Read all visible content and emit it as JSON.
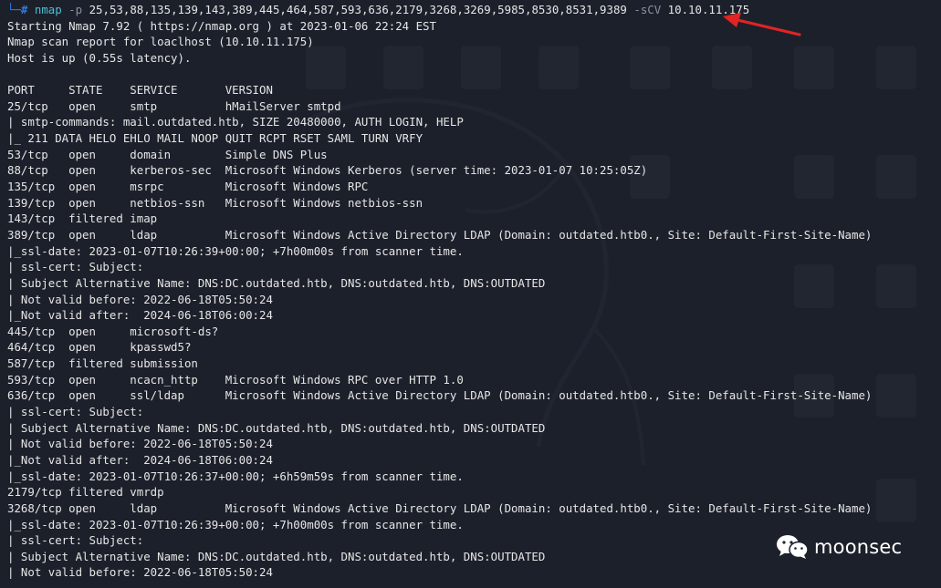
{
  "terminal": {
    "command": {
      "prompt_corner": "└─",
      "prompt_symbol": "#",
      "program": "nmap",
      "port_flag": "-p",
      "ports": "25,53,88,135,139,143,389,445,464,587,593,636,2179,3268,3269,5985,8530,8531,9389",
      "scan_flag": "-sCV",
      "target": "10.10.11.175"
    },
    "lines": [
      "Starting Nmap 7.92 ( https://nmap.org ) at 2023-01-06 22:24 EST",
      "Nmap scan report for loaclhost (10.10.11.175)",
      "Host is up (0.55s latency).",
      "",
      "PORT     STATE    SERVICE       VERSION",
      "25/tcp   open     smtp          hMailServer smtpd",
      "| smtp-commands: mail.outdated.htb, SIZE 20480000, AUTH LOGIN, HELP",
      "|_ 211 DATA HELO EHLO MAIL NOOP QUIT RCPT RSET SAML TURN VRFY",
      "53/tcp   open     domain        Simple DNS Plus",
      "88/tcp   open     kerberos-sec  Microsoft Windows Kerberos (server time: 2023-01-07 10:25:05Z)",
      "135/tcp  open     msrpc         Microsoft Windows RPC",
      "139/tcp  open     netbios-ssn   Microsoft Windows netbios-ssn",
      "143/tcp  filtered imap",
      "389/tcp  open     ldap          Microsoft Windows Active Directory LDAP (Domain: outdated.htb0., Site: Default-First-Site-Name)",
      "|_ssl-date: 2023-01-07T10:26:39+00:00; +7h00m00s from scanner time.",
      "| ssl-cert: Subject:",
      "| Subject Alternative Name: DNS:DC.outdated.htb, DNS:outdated.htb, DNS:OUTDATED",
      "| Not valid before: 2022-06-18T05:50:24",
      "|_Not valid after:  2024-06-18T06:00:24",
      "445/tcp  open     microsoft-ds?",
      "464/tcp  open     kpasswd5?",
      "587/tcp  filtered submission",
      "593/tcp  open     ncacn_http    Microsoft Windows RPC over HTTP 1.0",
      "636/tcp  open     ssl/ldap      Microsoft Windows Active Directory LDAP (Domain: outdated.htb0., Site: Default-First-Site-Name)",
      "| ssl-cert: Subject:",
      "| Subject Alternative Name: DNS:DC.outdated.htb, DNS:outdated.htb, DNS:OUTDATED",
      "| Not valid before: 2022-06-18T05:50:24",
      "|_Not valid after:  2024-06-18T06:00:24",
      "|_ssl-date: 2023-01-07T10:26:37+00:00; +6h59m59s from scanner time.",
      "2179/tcp filtered vmrdp",
      "3268/tcp open     ldap          Microsoft Windows Active Directory LDAP (Domain: outdated.htb0., Site: Default-First-Site-Name)",
      "|_ssl-date: 2023-01-07T10:26:39+00:00; +7h00m00s from scanner time.",
      "| ssl-cert: Subject:",
      "| Subject Alternative Name: DNS:DC.outdated.htb, DNS:outdated.htb, DNS:OUTDATED",
      "| Not valid before: 2022-06-18T05:50:24"
    ]
  },
  "annotation": {
    "arrow_color": "#e02424",
    "icon": "red-arrow-icon"
  },
  "watermark": {
    "icon": "wechat-icon",
    "text": "moonsec"
  },
  "colors": {
    "background": "#1c202b",
    "text": "#e6e6e6",
    "prompt": "#2f7de1",
    "program": "#46c0d4",
    "flag": "#8e8ea6"
  }
}
